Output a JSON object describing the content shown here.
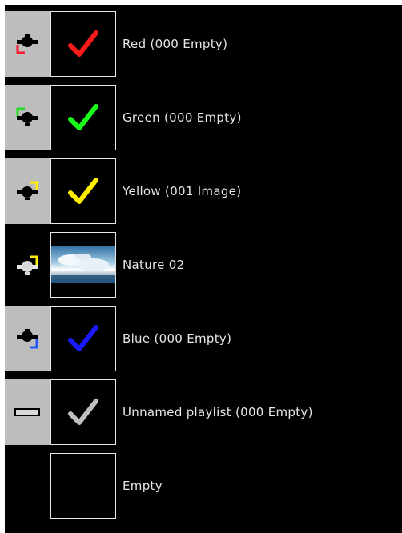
{
  "playlists": [
    {
      "label": "Red (000 Empty)",
      "state_icon": "camera-bracket-icon",
      "check_color": "#ff1a1a",
      "bracket_color": "#ff1a2e",
      "bracket_corner": "bottom-left",
      "thumb": "check"
    },
    {
      "label": "Green (000 Empty)",
      "state_icon": "camera-bracket-icon",
      "check_color": "#1aff1a",
      "bracket_color": "#22dd22",
      "bracket_corner": "top-left",
      "thumb": "check"
    },
    {
      "label": "Yellow (001 Image)",
      "state_icon": "camera-bracket-icon",
      "check_color": "#ffee00",
      "bracket_color": "#ffee00",
      "bracket_corner": "top-right",
      "thumb": "check"
    },
    {
      "label": "Nature 02",
      "state_icon": "camera-bracket-icon",
      "check_color": "",
      "bracket_color": "#ffee00",
      "bracket_corner": "top-right",
      "thumb": "image"
    },
    {
      "label": "Blue (000 Empty)",
      "state_icon": "camera-bracket-icon",
      "check_color": "#1a1aff",
      "bracket_color": "#2255ff",
      "bracket_corner": "bottom-right",
      "thumb": "check"
    },
    {
      "label": "Unnamed playlist (000 Empty)",
      "state_icon": "minus-bar-icon",
      "check_color": "#bfbfbf",
      "bracket_color": "",
      "bracket_corner": "",
      "thumb": "check"
    },
    {
      "label": "Empty",
      "state_icon": "none",
      "check_color": "",
      "bracket_color": "",
      "bracket_corner": "",
      "thumb": "empty"
    }
  ]
}
